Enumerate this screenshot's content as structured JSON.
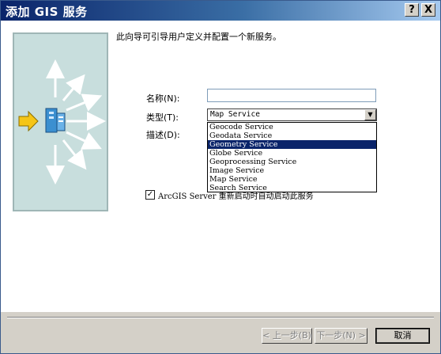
{
  "window": {
    "title": "添加 GIS 服务",
    "help_button": "?",
    "close_button": "X"
  },
  "intro": "此向导可引导用户定义并配置一个新服务。",
  "form": {
    "name_label": "名称(N):",
    "name_value": "",
    "type_label": "类型(T):",
    "type_selected": "Map Service",
    "description_label": "描述(D):",
    "type_options": [
      "Geocode Service",
      "Geodata Service",
      "Geometry Service",
      "Globe Service",
      "Geoprocessing Service",
      "Image Service",
      "Map Service",
      "Search Service"
    ],
    "highlighted_option": "Geometry Service",
    "autostart_label": "ArcGIS Server 重新启动时自动启动此服务",
    "autostart_checked": true
  },
  "buttons": {
    "back": "< 上一步(B)",
    "next": "下一步(N) >",
    "cancel": "取消"
  },
  "colors": {
    "title_gradient_start": "#0a246a",
    "title_gradient_end": "#a6caf0",
    "selection": "#0a246a",
    "panel_bg": "#c8dedd",
    "arrow_icon": "#f5c518"
  },
  "icons": {
    "wizard_graphic": "server-broadcast-icon",
    "pointer_arrow": "yellow-arrow-icon"
  }
}
